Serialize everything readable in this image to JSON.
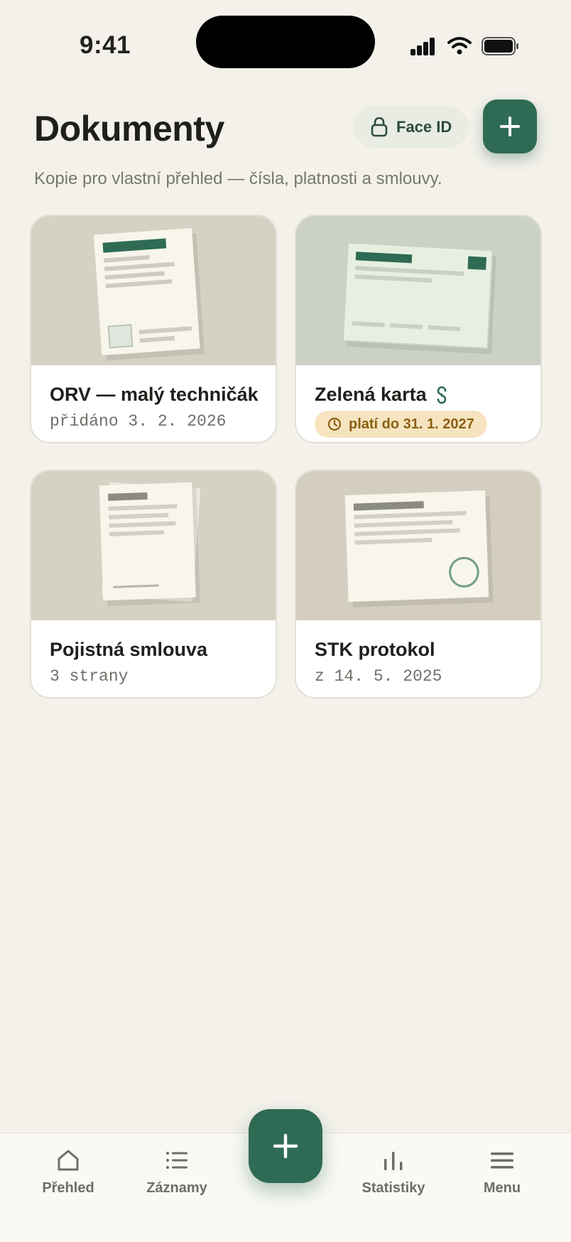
{
  "status": {
    "time": "9:41"
  },
  "header": {
    "title": "Dokumenty",
    "faceid_label": "Face ID",
    "subtitle": "Kopie pro vlastní přehled — čísla, platnosti a smlouvy."
  },
  "documents": [
    {
      "title": "ORV — malý techničák",
      "meta": "přidáno 3. 2. 2026"
    },
    {
      "title": "Zelená karta",
      "badge": "platí do 31. 1. 2027"
    },
    {
      "title": "Pojistná smlouva",
      "meta": "3 strany"
    },
    {
      "title": "STK protokol",
      "meta": "z 14. 5. 2025"
    }
  ],
  "tabs": [
    {
      "label": "Přehled",
      "icon": "home-icon"
    },
    {
      "label": "Záznamy",
      "icon": "list-icon"
    },
    {
      "label": "Statistiky",
      "icon": "bar-chart-icon"
    },
    {
      "label": "Menu",
      "icon": "menu-icon"
    }
  ],
  "colors": {
    "background": "#f3f1ea",
    "accent": "#2f6b54",
    "badge_bg": "#f6e4c0",
    "badge_text": "#8a5f12"
  }
}
